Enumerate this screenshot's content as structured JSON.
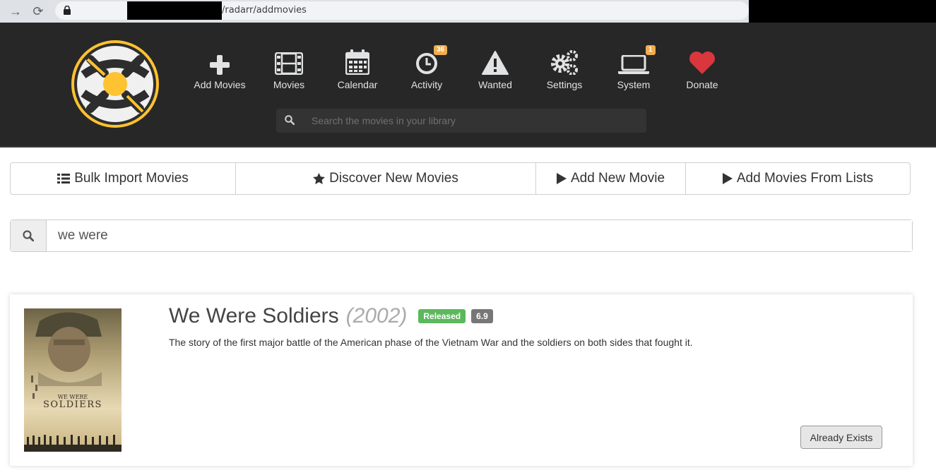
{
  "browser": {
    "url_path": "/radarr/addmovies"
  },
  "nav": {
    "items": [
      {
        "label": "Add Movies",
        "icon": "plus-icon"
      },
      {
        "label": "Movies",
        "icon": "film-icon"
      },
      {
        "label": "Calendar",
        "icon": "calendar-icon"
      },
      {
        "label": "Activity",
        "icon": "clock-icon",
        "badge": "36"
      },
      {
        "label": "Wanted",
        "icon": "warning-icon"
      },
      {
        "label": "Settings",
        "icon": "gears-icon"
      },
      {
        "label": "System",
        "icon": "laptop-icon",
        "badge": "1"
      },
      {
        "label": "Donate",
        "icon": "heart-icon"
      }
    ],
    "search_placeholder": "Search the movies in your library"
  },
  "tabs": {
    "bulk": "Bulk Import Movies",
    "discover": "Discover New Movies",
    "add_new": "Add New Movie",
    "lists": "Add Movies From Lists"
  },
  "lookup": {
    "value": "we were"
  },
  "result": {
    "title": "We Were Soldiers",
    "year": "(2002)",
    "status": "Released",
    "rating": "6.9",
    "overview": "The story of the first major battle of the American phase of the Vietnam War and the soldiers on both sides that fought it.",
    "action_label": "Already Exists",
    "poster_text_small": "WE WERE",
    "poster_text_large": "SOLDIERS"
  },
  "colors": {
    "header_bg": "#272727",
    "accent_yellow": "#ffc230",
    "released_green": "#5cb85c",
    "badge_orange": "#f0ad4e",
    "heart_red": "#d9363e"
  }
}
